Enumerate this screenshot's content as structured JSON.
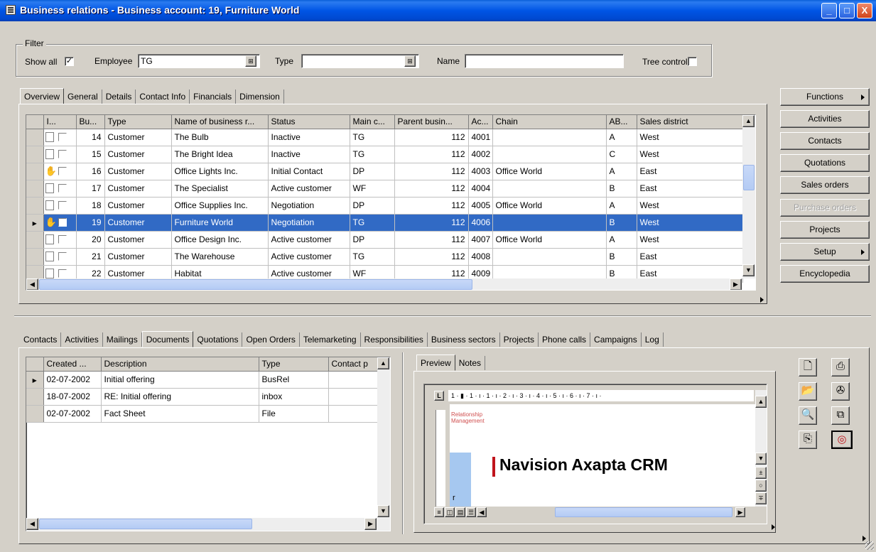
{
  "window": {
    "title": "Business relations - Business account: 19, Furniture World",
    "controls": {
      "minimize": "_",
      "maximize": "□",
      "close": "X"
    }
  },
  "filter": {
    "group_label": "Filter",
    "show_all_label": "Show all",
    "show_all_checked": "✓",
    "employee_label": "Employee",
    "employee_value": "TG",
    "type_label": "Type",
    "type_value": "",
    "name_label": "Name",
    "name_value": "",
    "tree_control_label": "Tree control"
  },
  "upper_tabs": [
    "Overview",
    "General",
    "Details",
    "Contact Info",
    "Financials",
    "Dimension"
  ],
  "upper_active_tab": "Overview",
  "grid": {
    "columns": [
      "",
      "I...",
      "Bu...",
      "Type",
      "Name of business r...",
      "Status",
      "Main c...",
      "Parent busin...",
      "Ac...",
      "Chain",
      "AB...",
      "Sales district"
    ],
    "rows": [
      {
        "bu": "14",
        "type": "Customer",
        "name": "The Bulb",
        "status": "Inactive",
        "main": "TG",
        "parent": "112",
        "ac": "4001",
        "chain": "",
        "ab": "A",
        "district": "West",
        "selected": false,
        "hand": false,
        "pointer": false
      },
      {
        "bu": "15",
        "type": "Customer",
        "name": "The Bright Idea",
        "status": "Inactive",
        "main": "TG",
        "parent": "112",
        "ac": "4002",
        "chain": "",
        "ab": "C",
        "district": "West",
        "selected": false,
        "hand": false,
        "pointer": false
      },
      {
        "bu": "16",
        "type": "Customer",
        "name": "Office Lights Inc.",
        "status": "Initial Contact",
        "main": "DP",
        "parent": "112",
        "ac": "4003",
        "chain": "Office World",
        "ab": "A",
        "district": "East",
        "selected": false,
        "hand": true,
        "pointer": false
      },
      {
        "bu": "17",
        "type": "Customer",
        "name": "The Specialist",
        "status": "Active customer",
        "main": "WF",
        "parent": "112",
        "ac": "4004",
        "chain": "",
        "ab": "B",
        "district": "East",
        "selected": false,
        "hand": false,
        "pointer": false
      },
      {
        "bu": "18",
        "type": "Customer",
        "name": "Office Supplies Inc.",
        "status": "Negotiation",
        "main": "DP",
        "parent": "112",
        "ac": "4005",
        "chain": "Office World",
        "ab": "A",
        "district": "West",
        "selected": false,
        "hand": false,
        "pointer": false
      },
      {
        "bu": "19",
        "type": "Customer",
        "name": "Furniture World",
        "status": "Negotiation",
        "main": "TG",
        "parent": "112",
        "ac": "4006",
        "chain": "",
        "ab": "B",
        "district": "West",
        "selected": true,
        "hand": true,
        "pointer": true
      },
      {
        "bu": "20",
        "type": "Customer",
        "name": "Office Design Inc.",
        "status": "Active customer",
        "main": "DP",
        "parent": "112",
        "ac": "4007",
        "chain": "Office World",
        "ab": "A",
        "district": "West",
        "selected": false,
        "hand": false,
        "pointer": false
      },
      {
        "bu": "21",
        "type": "Customer",
        "name": "The Warehouse",
        "status": "Active customer",
        "main": "TG",
        "parent": "112",
        "ac": "4008",
        "chain": "",
        "ab": "B",
        "district": "East",
        "selected": false,
        "hand": false,
        "pointer": false
      },
      {
        "bu": "22",
        "type": "Customer",
        "name": "Habitat",
        "status": "Active customer",
        "main": "WF",
        "parent": "112",
        "ac": "4009",
        "chain": "",
        "ab": "B",
        "district": "East",
        "selected": false,
        "hand": false,
        "pointer": false
      }
    ]
  },
  "side_buttons": {
    "functions": "Functions",
    "activities": "Activities",
    "contacts": "Contacts",
    "quotations": "Quotations",
    "sales_orders": "Sales orders",
    "purchase_orders": "Purchase orders",
    "projects": "Projects",
    "setup": "Setup",
    "encyclopedia": "Encyclopedia"
  },
  "lower_tabs": [
    "Contacts",
    "Activities",
    "Mailings",
    "Documents",
    "Quotations",
    "Open Orders",
    "Telemarketing",
    "Responsibilities",
    "Business sectors",
    "Projects",
    "Phone calls",
    "Campaigns",
    "Log"
  ],
  "lower_active_tab": "Documents",
  "documents": {
    "columns": [
      "",
      "Created ...",
      "Description",
      "Type",
      "Contact p"
    ],
    "rows": [
      {
        "created": "02-07-2002",
        "description": "Initial offering",
        "type": "BusRel",
        "contact": "",
        "pointer": true
      },
      {
        "created": "18-07-2002",
        "description": "RE: Initial offering",
        "type": "inbox",
        "contact": "",
        "pointer": false
      },
      {
        "created": "02-07-2002",
        "description": "Fact Sheet",
        "type": "File",
        "contact": "",
        "pointer": false
      }
    ]
  },
  "preview": {
    "tabs": [
      "Preview",
      "Notes"
    ],
    "active_tab": "Preview",
    "ruler_text": "1 · ▮ · 1 · ı · 1 · ı · 2 · ı · 3 · ı · 4 · ı · 5 · ı · 6 · ı · 7 · ı ·",
    "doc_small_text": [
      "Relationship",
      "Management"
    ],
    "doc_heading": "Navision Axapta CRM",
    "doc_margin_letter": "r",
    "accent_color": "#c0141c"
  },
  "colors": {
    "selection": "#316ac5",
    "titlebar": "#0055e5",
    "face": "#d4d0c8"
  }
}
